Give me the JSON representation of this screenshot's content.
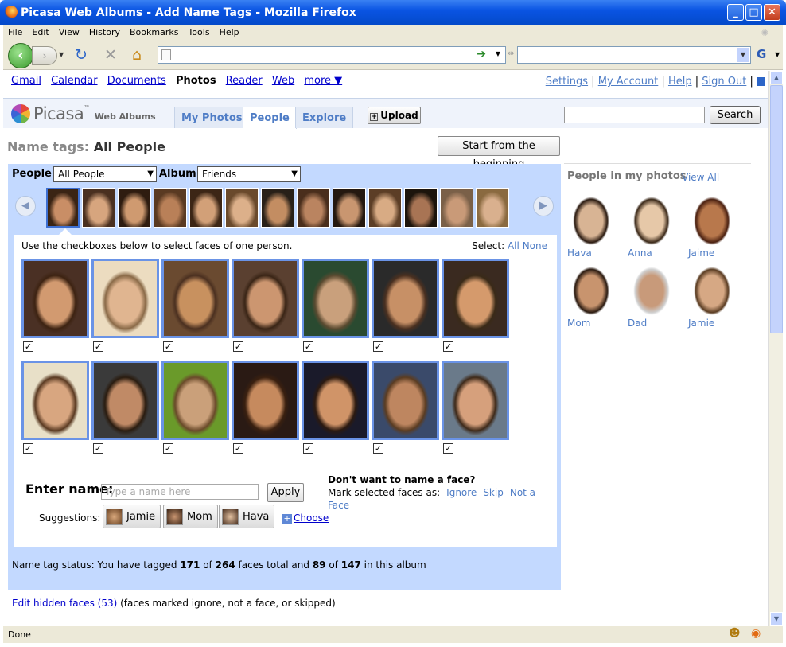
{
  "window": {
    "title": "Picasa Web Albums - Add Name Tags - Mozilla Firefox",
    "min": "_",
    "max": "□",
    "close": "✕"
  },
  "menu": [
    "File",
    "Edit",
    "View",
    "History",
    "Bookmarks",
    "Tools",
    "Help"
  ],
  "status_text": "Done",
  "gbar": {
    "left": [
      "Gmail",
      "Calendar",
      "Documents",
      "Photos",
      "Reader",
      "Web",
      "more ▼"
    ],
    "right": {
      "settings": "Settings",
      "account": "My Account",
      "help": "Help",
      "signout": "Sign Out",
      "sep": "|"
    }
  },
  "logo": {
    "name": "Picasa",
    "tm": "™",
    "sub": "Web Albums"
  },
  "tabs": [
    "My Photos",
    "People",
    "Explore"
  ],
  "upload_label": "Upload",
  "search_label": "Search",
  "page": {
    "title_prefix": "Name tags:",
    "title": "All People",
    "start_button": "Start from the beginning"
  },
  "filters": {
    "people_label": "People:",
    "people_value": "All People",
    "album_label": "Album:",
    "album_value": "Friends"
  },
  "instructions": "Use the checkboxes below to select faces of one person.",
  "select": {
    "label": "Select:",
    "all": "All",
    "none": "None"
  },
  "naming": {
    "label": "Enter name:",
    "placeholder": "Type a name here",
    "apply": "Apply",
    "heading": "Don't want to name a face?",
    "mark_text": "Mark selected faces as:",
    "ignore": "Ignore",
    "skip": "Skip",
    "notface": "Not a Face"
  },
  "suggestions": {
    "label": "Suggestions:",
    "items": [
      "Jamie",
      "Mom",
      "Hava"
    ],
    "choose": "Choose"
  },
  "status": {
    "prefix": "Name tag status:  You have tagged",
    "tagged": "171",
    "of": "of",
    "total": "264",
    "mid": "faces total and",
    "album_tagged": "89",
    "album_total": "147",
    "suffix": "in this album"
  },
  "hidden": {
    "link": "Edit hidden faces (53)",
    "note": "(faces marked ignore, not a face, or skipped)"
  },
  "sidebar": {
    "title": "People in my photos",
    "view_all": "View All",
    "people": [
      "Hava",
      "Anna",
      "Jaime",
      "Mom",
      "Dad",
      "Jamie"
    ]
  },
  "colors": {
    "titlebar": "#0a54e3",
    "panel": "#c3d9ff",
    "link": "#4f7dc6",
    "face_border": "#6a93e6"
  }
}
